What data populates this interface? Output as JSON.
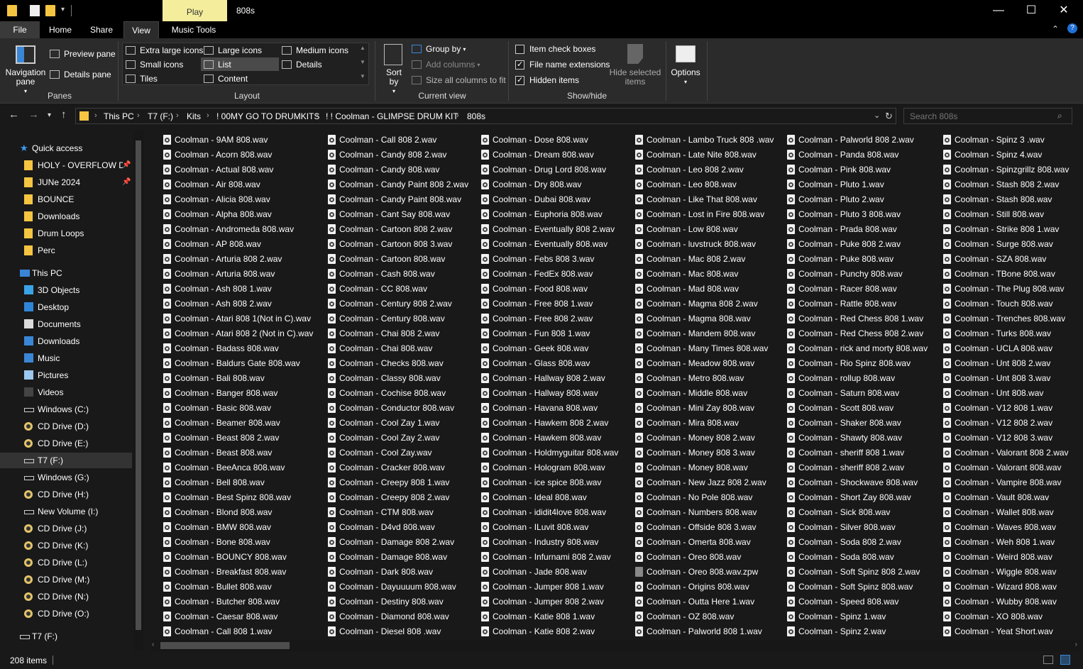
{
  "title_bar": {
    "context_tab": "Play",
    "window_title": "808s",
    "minimize": "—",
    "maximize": "☐",
    "close": "✕"
  },
  "tabs": [
    "File",
    "Home",
    "Share",
    "View",
    "Music Tools"
  ],
  "ribbon": {
    "panes": {
      "navigation_pane": "Navigation pane",
      "preview_pane": "Preview pane",
      "details_pane": "Details pane",
      "label": "Panes"
    },
    "layout": {
      "options": [
        "Extra large icons",
        "Large icons",
        "Medium icons",
        "Small icons",
        "List",
        "Details",
        "Tiles",
        "Content"
      ],
      "selected": "List",
      "label": "Layout"
    },
    "current_view": {
      "sort_by": "Sort by",
      "group_by": "Group by",
      "add_columns": "Add columns",
      "size_all_columns": "Size all columns to fit",
      "label": "Current view"
    },
    "show_hide": {
      "item_check_boxes": "Item check boxes",
      "item_check_boxes_checked": false,
      "file_name_extensions": "File name extensions",
      "file_name_extensions_checked": true,
      "hidden_items": "Hidden items",
      "hidden_items_checked": true,
      "hide_selected_items": "Hide selected items",
      "label": "Show/hide"
    },
    "options": "Options"
  },
  "address": {
    "crumbs": [
      "This PC",
      "T7 (F:)",
      "Kits",
      "! 00MY GO TO DRUMKITS",
      "! ! Coolman - GLIMPSE DRUM KIT",
      "808s"
    ],
    "search_placeholder": "Search 808s"
  },
  "nav": {
    "quick_access": "Quick access",
    "pinned": [
      "HOLY - OVERFLOW DR",
      "JUNe 2024",
      "BOUNCE",
      "Downloads",
      "Drum Loops",
      "Perc"
    ],
    "this_pc": "This PC",
    "pc_items": [
      "3D Objects",
      "Desktop",
      "Documents",
      "Downloads",
      "Music",
      "Pictures",
      "Videos",
      "Windows (C:)",
      "CD Drive (D:)",
      "CD Drive (E:)",
      "T7 (F:)",
      "Windows (G:)",
      "CD Drive (H:)",
      "New Volume (I:)",
      "CD Drive (J:)",
      "CD Drive (K:)",
      "CD Drive (L:)",
      "CD Drive (M:)",
      "CD Drive (N:)",
      "CD Drive (O:)"
    ],
    "bottom_item": "T7 (F:)"
  },
  "files": [
    [
      "Coolman - 9AM 808.wav",
      "Coolman - Acorn 808.wav",
      "Coolman - Actual 808.wav",
      "Coolman - Air 808.wav",
      "Coolman - Alicia 808.wav",
      "Coolman - Alpha 808.wav",
      "Coolman - Andromeda 808.wav",
      "Coolman - AP 808.wav",
      "Coolman - Arturia 808 2.wav",
      "Coolman - Arturia 808.wav",
      "Coolman - Ash 808 1.wav",
      "Coolman - Ash 808 2.wav",
      "Coolman - Atari 808 1(Not in C).wav",
      "Coolman - Atari 808 2 (Not in C).wav",
      "Coolman - Badass 808.wav",
      "Coolman - Baldurs Gate 808.wav",
      "Coolman - Bali 808.wav",
      "Coolman - Banger 808.wav",
      "Coolman - Basic 808.wav",
      "Coolman - Beamer 808.wav",
      "Coolman - Beast 808 2.wav",
      "Coolman - Beast 808.wav",
      "Coolman - BeeAnca 808.wav",
      "Coolman - Bell 808.wav",
      "Coolman - Best Spinz 808.wav",
      "Coolman - Blond 808.wav",
      "Coolman - BMW 808.wav",
      "Coolman - Bone 808.wav",
      "Coolman - BOUNCY 808.wav",
      "Coolman - Breakfast 808.wav",
      "Coolman - Bullet 808.wav",
      "Coolman - Butcher 808.wav",
      "Coolman - Caesar 808.wav",
      "Coolman - Call 808 1.wav"
    ],
    [
      "Coolman - Call 808 2.wav",
      "Coolman - Candy 808 2.wav",
      "Coolman - Candy 808.wav",
      "Coolman - Candy Paint 808 2.wav",
      "Coolman - Candy Paint 808.wav",
      "Coolman - Cant Say 808.wav",
      "Coolman - Cartoon 808 2.wav",
      "Coolman - Cartoon 808 3.wav",
      "Coolman - Cartoon 808.wav",
      "Coolman - Cash 808.wav",
      "Coolman - CC 808.wav",
      "Coolman - Century 808 2.wav",
      "Coolman - Century 808.wav",
      "Coolman - Chai 808 2.wav",
      "Coolman - Chai 808.wav",
      "Coolman - Checks 808.wav",
      "Coolman - Classy 808.wav",
      "Coolman - Cochise 808.wav",
      "Coolman - Conductor 808.wav",
      "Coolman - Cool Zay 1.wav",
      "Coolman - Cool Zay 2.wav",
      "Coolman - Cool Zay.wav",
      "Coolman - Cracker 808.wav",
      "Coolman - Creepy 808 1.wav",
      "Coolman - Creepy 808 2.wav",
      "Coolman - CTM 808.wav",
      "Coolman - D4vd 808.wav",
      "Coolman - Damage 808 2.wav",
      "Coolman - Damage 808.wav",
      "Coolman - Dark 808.wav",
      "Coolman - Dayuuuum 808.wav",
      "Coolman - Destiny 808.wav",
      "Coolman - Diamond 808.wav",
      "Coolman - Diesel 808 .wav"
    ],
    [
      "Coolman - Dose 808.wav",
      "Coolman - Dream 808.wav",
      "Coolman - Drug Lord 808.wav",
      "Coolman - Dry 808.wav",
      "Coolman - Dubai 808.wav",
      "Coolman - Euphoria 808.wav",
      "Coolman - Eventually 808 2.wav",
      "Coolman - Eventually 808.wav",
      "Coolman - Febs 808 3.wav",
      "Coolman - FedEx 808.wav",
      "Coolman - Food 808.wav",
      "Coolman - Free 808 1.wav",
      "Coolman - Free 808 2.wav",
      "Coolman - Fun 808 1.wav",
      "Coolman - Geek 808.wav",
      "Coolman - Glass 808.wav",
      "Coolman - Hallway 808 2.wav",
      "Coolman - Hallway 808.wav",
      "Coolman - Havana 808.wav",
      "Coolman - Hawkem 808 2.wav",
      "Coolman - Hawkem 808.wav",
      "Coolman - Holdmyguitar 808.wav",
      "Coolman - Hologram 808.wav",
      "Coolman - ice spice 808.wav",
      "Coolman - Ideal 808.wav",
      "Coolman - ididit4love 808.wav",
      "Coolman - ILuvit 808.wav",
      "Coolman - Industry 808.wav",
      "Coolman - Infurnami 808 2.wav",
      "Coolman - Jade 808.wav",
      "Coolman - Jumper 808 1.wav",
      "Coolman - Jumper 808 2.wav",
      "Coolman - Katie 808 1.wav",
      "Coolman - Katie 808 2.wav"
    ],
    [
      "Coolman - Lambo Truck 808 .wav",
      "Coolman - Late Nite 808.wav",
      "Coolman - Leo 808 2.wav",
      "Coolman - Leo 808.wav",
      "Coolman - Like That 808.wav",
      "Coolman - Lost in Fire 808.wav",
      "Coolman - Low 808.wav",
      "Coolman - luvstruck 808.wav",
      "Coolman - Mac 808 2.wav",
      "Coolman - Mac 808.wav",
      "Coolman - Mad 808.wav",
      "Coolman - Magma 808 2.wav",
      "Coolman - Magma 808.wav",
      "Coolman - Mandem 808.wav",
      "Coolman - Many Times 808.wav",
      "Coolman - Meadow 808.wav",
      "Coolman - Metro 808.wav",
      "Coolman - Middle 808.wav",
      "Coolman - Mini Zay 808.wav",
      "Coolman - Mira 808.wav",
      "Coolman - Money 808 2.wav",
      "Coolman - Money 808 3.wav",
      "Coolman - Money 808.wav",
      "Coolman - New Jazz 808 2.wav",
      "Coolman - No Pole 808.wav",
      "Coolman - Numbers 808.wav",
      "Coolman - Offside 808 3.wav",
      "Coolman - Omerta 808.wav",
      "Coolman - Oreo 808.wav",
      "Coolman - Oreo 808.wav.zpw",
      "Coolman - Origins 808.wav",
      "Coolman - Outta Here 1.wav",
      "Coolman - OZ 808.wav",
      "Coolman - Palworld 808 1.wav"
    ],
    [
      "Coolman - Palworld 808 2.wav",
      "Coolman - Panda 808.wav",
      "Coolman - Pink 808.wav",
      "Coolman - Pluto 1.wav",
      "Coolman - Pluto 2.wav",
      "Coolman - Pluto 3 808.wav",
      "Coolman - Prada 808.wav",
      "Coolman - Puke 808 2.wav",
      "Coolman - Puke 808.wav",
      "Coolman - Punchy 808.wav",
      "Coolman - Racer 808.wav",
      "Coolman - Rattle 808.wav",
      "Coolman - Red Chess 808 1.wav",
      "Coolman - Red Chess 808 2.wav",
      "Coolman - rick and morty 808.wav",
      "Coolman - Rio Spinz 808.wav",
      "Coolman - rollup 808.wav",
      "Coolman - Saturn 808.wav",
      "Coolman - Scott 808.wav",
      "Coolman - Shaker 808.wav",
      "Coolman - Shawty 808.wav",
      "Coolman - sheriff 808 1.wav",
      "Coolman - sheriff 808 2.wav",
      "Coolman - Shockwave 808.wav",
      "Coolman - Short Zay 808.wav",
      "Coolman - Sick 808.wav",
      "Coolman - Silver 808.wav",
      "Coolman - Soda 808 2.wav",
      "Coolman - Soda 808.wav",
      "Coolman - Soft Spinz 808 2.wav",
      "Coolman - Soft Spinz 808.wav",
      "Coolman - Speed 808.wav",
      "Coolman - Spinz 1.wav",
      "Coolman - Spinz 2.wav"
    ],
    [
      "Coolman - Spinz 3 .wav",
      "Coolman - Spinz 4.wav",
      "Coolman - Spinzgrillz 808.wav",
      "Coolman - Stash 808 2.wav",
      "Coolman - Stash 808.wav",
      "Coolman - Still 808.wav",
      "Coolman - Strike 808 1.wav",
      "Coolman - Surge 808.wav",
      "Coolman - SZA 808.wav",
      "Coolman - TBone 808.wav",
      "Coolman - The Plug 808.wav",
      "Coolman - Touch 808.wav",
      "Coolman - Trenches 808.wav",
      "Coolman - Turks 808.wav",
      "Coolman - UCLA 808.wav",
      "Coolman - Unt 808 2.wav",
      "Coolman - Unt 808 3.wav",
      "Coolman - Unt 808.wav",
      "Coolman - V12 808 1.wav",
      "Coolman - V12 808 2.wav",
      "Coolman - V12 808 3.wav",
      "Coolman - Valorant 808 2.wav",
      "Coolman - Valorant 808.wav",
      "Coolman - Vampire 808.wav",
      "Coolman - Vault 808.wav",
      "Coolman - Wallet 808.wav",
      "Coolman - Waves 808.wav",
      "Coolman - Weh 808 1.wav",
      "Coolman - Weird 808.wav",
      "Coolman - Wiggle 808.wav",
      "Coolman - Wizard 808.wav",
      "Coolman - Wubby 808.wav",
      "Coolman - XO 808.wav",
      "Coolman - Yeat Short.wav"
    ]
  ],
  "status": {
    "item_count": "208 items"
  }
}
